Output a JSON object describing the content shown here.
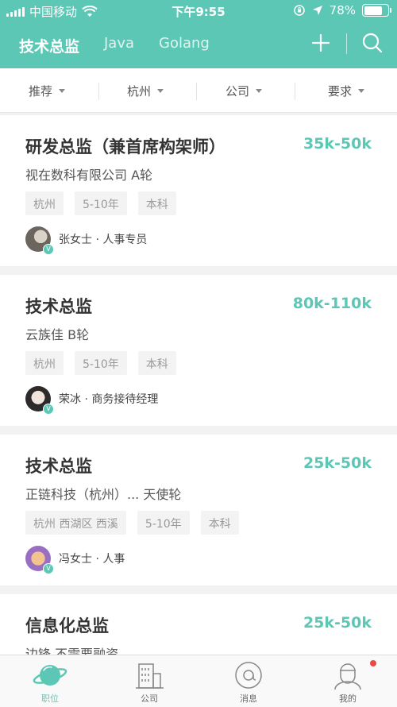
{
  "status_bar": {
    "carrier": "中国移动",
    "time": "下午9:55",
    "battery": "78%",
    "battery_level": 0.78
  },
  "nav": {
    "tabs": [
      {
        "label": "技术总监",
        "active": true
      },
      {
        "label": "Java",
        "active": false
      },
      {
        "label": "Golang",
        "active": false
      }
    ],
    "icons": [
      "plus-icon",
      "search-icon"
    ]
  },
  "filters": [
    {
      "label": "推荐"
    },
    {
      "label": "杭州"
    },
    {
      "label": "公司"
    },
    {
      "label": "要求"
    }
  ],
  "jobs": [
    {
      "title": "研发总监（兼首席构架师）",
      "salary": "35k-50k",
      "company": "视在数科有限公司 A轮",
      "tags": [
        "杭州",
        "5-10年",
        "本科"
      ],
      "recruiter": "张女士 · 人事专员"
    },
    {
      "title": "技术总监",
      "salary": "80k-110k",
      "company": "云族佳 B轮",
      "tags": [
        "杭州",
        "5-10年",
        "本科"
      ],
      "recruiter": "荣冰 · 商务接待经理"
    },
    {
      "title": "技术总监",
      "salary": "25k-50k",
      "company": "正链科技（杭州）... 天使轮",
      "tags": [
        "杭州 西湖区 西溪",
        "5-10年",
        "本科"
      ],
      "recruiter": "冯女士 · 人事"
    },
    {
      "title": "信息化总监",
      "salary": "25k-50k",
      "company": "边锋 不需要融资"
    }
  ],
  "tabbar": [
    {
      "label": "职位",
      "icon": "planet-icon",
      "active": true
    },
    {
      "label": "公司",
      "icon": "building-icon",
      "active": false
    },
    {
      "label": "消息",
      "icon": "chat-icon",
      "active": false
    },
    {
      "label": "我的",
      "icon": "profile-icon",
      "active": false,
      "badge": true
    }
  ],
  "colors": {
    "accent": "#5dc7b6",
    "badge": "#e84a45"
  }
}
